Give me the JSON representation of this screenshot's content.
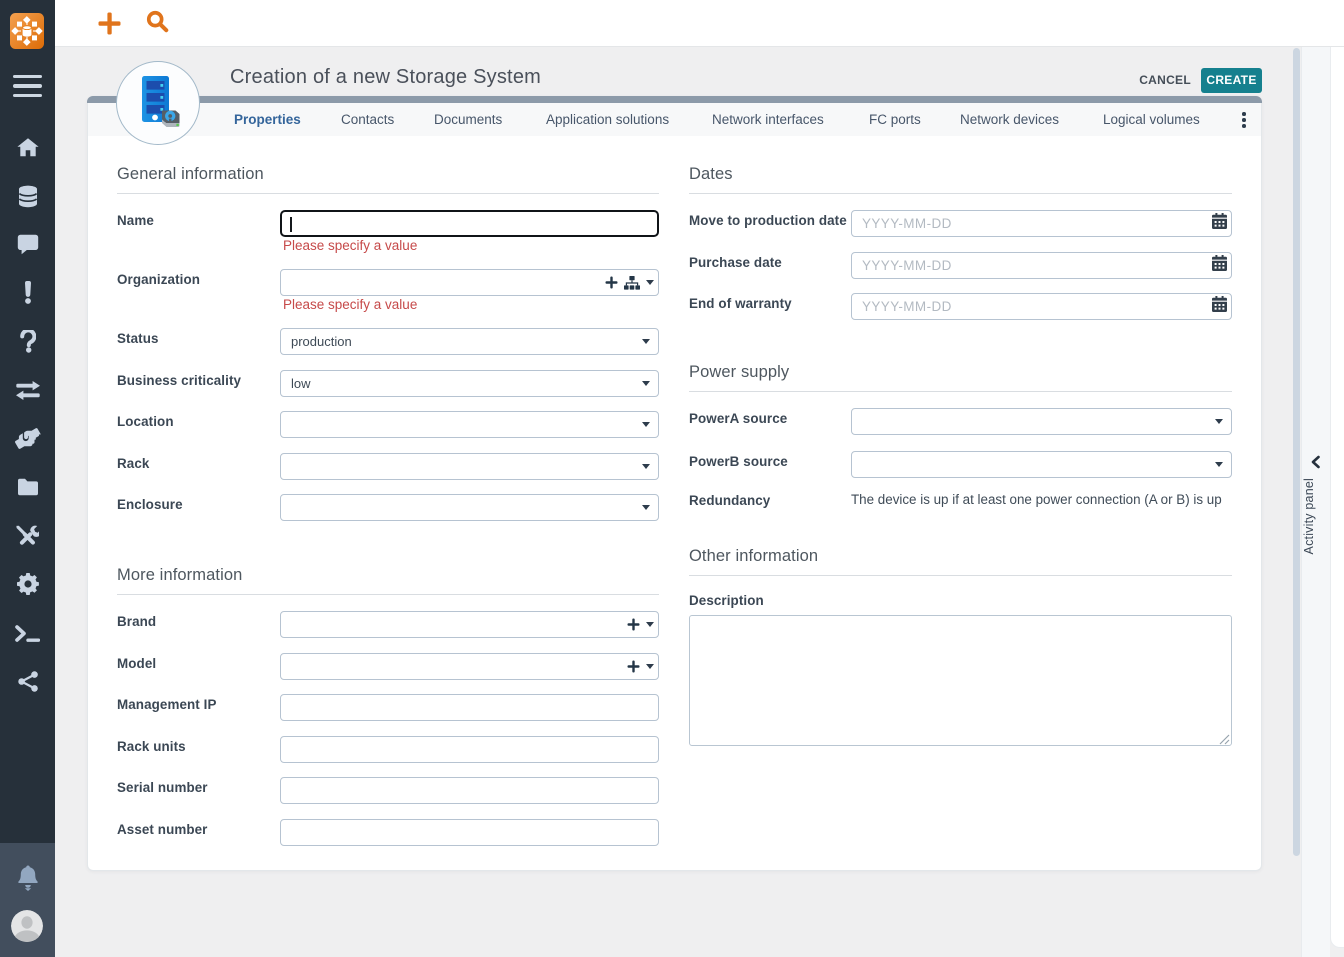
{
  "colors": {
    "accent_orange": "#e0741c",
    "create_teal": "#15808e",
    "sidebar_dark": "#26303a",
    "sidebar_bottom": "#424e5d",
    "active_tab_blue": "#34659b",
    "error_red": "#c64a4a",
    "card_strip_gray": "#8c9aa9"
  },
  "sidebar": {
    "logo_icon": "itop-logo",
    "menu_toggle_icon": "hamburger-icon",
    "nav_items": [
      {
        "id": "home",
        "icon": "home-icon"
      },
      {
        "id": "data-administration",
        "icon": "database-icon"
      },
      {
        "id": "helpdesk",
        "icon": "comment-icon"
      },
      {
        "id": "incident-management",
        "icon": "exclamation-icon"
      },
      {
        "id": "problem-management",
        "icon": "question-icon"
      },
      {
        "id": "change-management",
        "icon": "exchange-icon"
      },
      {
        "id": "service-management",
        "icon": "handshake-icon"
      },
      {
        "id": "configuration-management",
        "icon": "folder-icon"
      },
      {
        "id": "admin-tools",
        "icon": "tools-icon"
      },
      {
        "id": "system-settings",
        "icon": "gear-icon"
      },
      {
        "id": "console",
        "icon": "terminal-icon"
      },
      {
        "id": "synchronization",
        "icon": "share-icon"
      }
    ],
    "bottom_items": [
      {
        "id": "notifications",
        "icon": "bell-icon"
      },
      {
        "id": "user-menu",
        "icon": "avatar"
      }
    ]
  },
  "topbar": {
    "actions": [
      {
        "id": "new-object",
        "icon": "plus-icon"
      },
      {
        "id": "global-search",
        "icon": "search-icon"
      }
    ]
  },
  "page": {
    "title": "Creation of a new Storage System",
    "object_icon": "storage-system-icon",
    "cancel_label": "CANCEL",
    "create_label": "CREATE",
    "tabs": [
      {
        "label": "Properties",
        "active": true
      },
      {
        "label": "Contacts",
        "active": false
      },
      {
        "label": "Documents",
        "active": false
      },
      {
        "label": "Application solutions",
        "active": false
      },
      {
        "label": "Network interfaces",
        "active": false
      },
      {
        "label": "FC ports",
        "active": false
      },
      {
        "label": "Network devices",
        "active": false
      },
      {
        "label": "Logical volumes",
        "active": false
      }
    ],
    "more_tabs_icon": "kebab-icon"
  },
  "form": {
    "sections": [
      {
        "dom_id": "sec-general",
        "side": "left",
        "title": "General information",
        "fields": [
          {
            "id": "name",
            "label": "Name",
            "type": "text",
            "value": "",
            "focused": true,
            "error": "Please specify a value"
          },
          {
            "id": "organization",
            "label": "Organization",
            "type": "combo",
            "value": "",
            "icons": [
              "plus-icon",
              "sitemap-icon",
              "caret-down-icon"
            ],
            "error": "Please specify a value"
          },
          {
            "id": "status",
            "label": "Status",
            "type": "select",
            "value": "production",
            "extra_class": "mt"
          },
          {
            "id": "business-criticality",
            "label": "Business criticality",
            "type": "select",
            "value": "low"
          },
          {
            "id": "location",
            "label": "Location",
            "type": "select",
            "value": ""
          },
          {
            "id": "rack",
            "label": "Rack",
            "type": "select",
            "value": ""
          },
          {
            "id": "enclosure",
            "label": "Enclosure",
            "type": "select",
            "value": ""
          }
        ]
      },
      {
        "dom_id": "sec-more",
        "side": "left",
        "title": "More information",
        "fields": [
          {
            "id": "brand",
            "label": "Brand",
            "type": "combo",
            "value": "",
            "icons": [
              "plus-icon",
              "caret-down-icon"
            ]
          },
          {
            "id": "model",
            "label": "Model",
            "type": "combo",
            "value": "",
            "icons": [
              "plus-icon",
              "caret-down-icon"
            ]
          },
          {
            "id": "management-ip",
            "label": "Management IP",
            "type": "text",
            "value": ""
          },
          {
            "id": "rack-units",
            "label": "Rack units",
            "type": "text",
            "value": ""
          },
          {
            "id": "serial-number",
            "label": "Serial number",
            "type": "text",
            "value": ""
          },
          {
            "id": "asset-number",
            "label": "Asset number",
            "type": "text",
            "value": ""
          }
        ]
      },
      {
        "dom_id": "sec-dates",
        "side": "right",
        "title": "Dates",
        "fields": [
          {
            "id": "move-to-production-date",
            "label": "Move to production date",
            "type": "date",
            "value": "",
            "placeholder": "YYYY-MM-DD",
            "icon": "calendar-icon"
          },
          {
            "id": "purchase-date",
            "label": "Purchase date",
            "type": "date",
            "value": "",
            "placeholder": "YYYY-MM-DD",
            "icon": "calendar-icon"
          },
          {
            "id": "end-of-warranty",
            "label": "End of warranty",
            "type": "date",
            "value": "",
            "placeholder": "YYYY-MM-DD",
            "icon": "calendar-icon"
          }
        ]
      },
      {
        "dom_id": "sec-power",
        "side": "right",
        "title": "Power supply",
        "fields": [
          {
            "id": "powera-source",
            "label": "PowerA source",
            "type": "select",
            "value": ""
          },
          {
            "id": "powerb-source",
            "label": "PowerB source",
            "type": "select",
            "value": ""
          },
          {
            "id": "redundancy",
            "label": "Redundancy",
            "type": "static",
            "value": "The device is up if at least one power connection (A or B) is up"
          }
        ]
      },
      {
        "dom_id": "sec-other",
        "side": "right",
        "title": "Other information",
        "fields": [
          {
            "id": "description",
            "label": "Description",
            "type": "textarea",
            "value": ""
          }
        ]
      }
    ]
  },
  "activity_panel": {
    "label": "Activity panel",
    "collapse_icon": "chevron-left-icon"
  }
}
